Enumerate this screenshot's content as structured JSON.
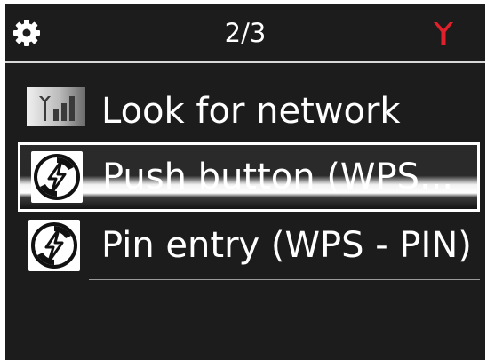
{
  "header": {
    "page_indicator": "2/3",
    "settings_icon": "gear-icon",
    "network_icon": "antenna-icon",
    "network_icon_color": "#e0202a"
  },
  "menu": {
    "items": [
      {
        "label": "Look for network",
        "icon": "signal-bars-icon",
        "selected": false
      },
      {
        "label": "Push button (WPS...",
        "icon": "wps-icon",
        "selected": true
      },
      {
        "label": "Pin entry (WPS - PIN)",
        "icon": "wps-icon",
        "selected": false
      }
    ]
  }
}
